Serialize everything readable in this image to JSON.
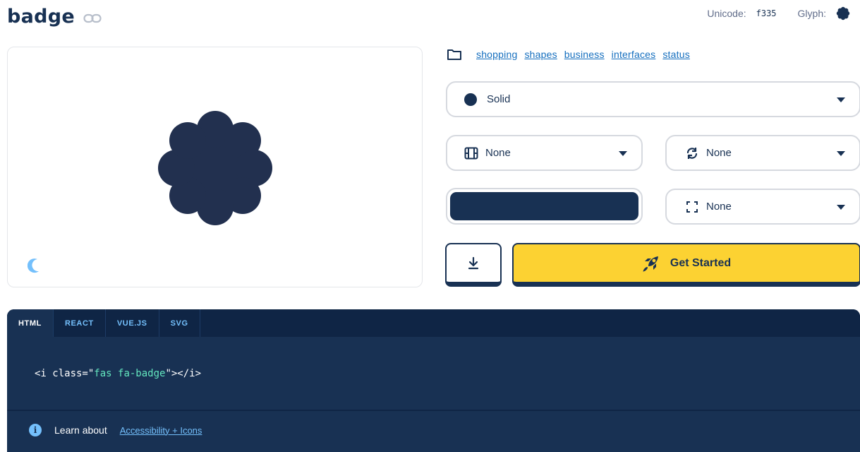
{
  "header": {
    "title": "badge",
    "unicode_label": "Unicode:",
    "unicode_value": "f335",
    "glyph_label": "Glyph:"
  },
  "categories": [
    "shopping",
    "shapes",
    "business",
    "interfaces",
    "status"
  ],
  "controls": {
    "style_value": "Solid",
    "animation_value": "None",
    "rotation_value": "None",
    "size_value": "None",
    "color": "#183153",
    "get_started_label": "Get Started"
  },
  "code": {
    "tabs": [
      "HTML",
      "REACT",
      "VUE.JS",
      "SVG"
    ],
    "active_tab": "HTML",
    "snippet_open": "<i class=\"",
    "snippet_class": "fas fa-badge",
    "snippet_close": "\"></i>"
  },
  "footer": {
    "learn_label": "Learn about",
    "link_label": "Accessibility + Icons"
  },
  "colors": {
    "brand_navy": "#183153",
    "accent_yellow": "#fcd232",
    "link_blue": "#146ebe",
    "code_green": "#63e6be"
  },
  "icons": [
    "link-icon",
    "badge-glyph-icon",
    "moon-icon",
    "folder-icon",
    "film-icon",
    "rotate-icon",
    "expand-icon",
    "download-icon",
    "rocket-icon",
    "info-icon"
  ]
}
